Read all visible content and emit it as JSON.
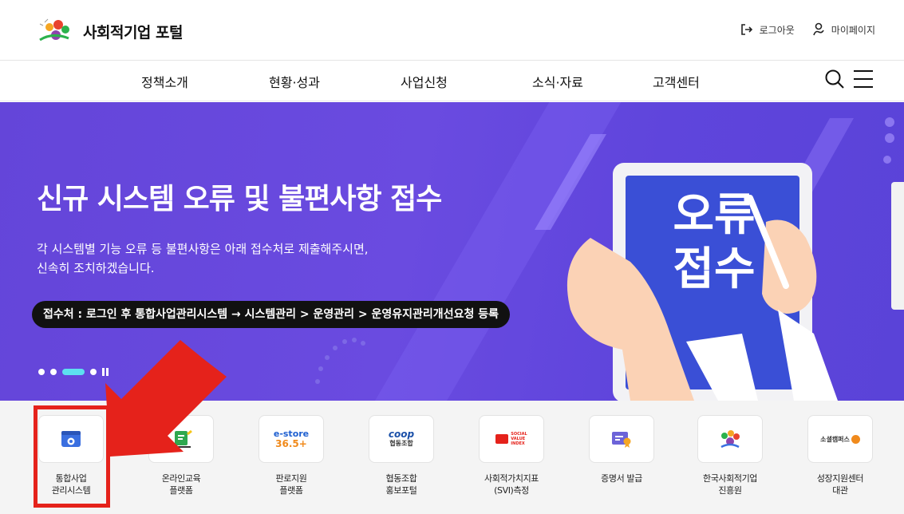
{
  "header": {
    "logo_text": "사회적기업 포털",
    "logout_label": "로그아웃",
    "mypage_label": "마이페이지"
  },
  "gnb": {
    "items": [
      {
        "label": "정책소개"
      },
      {
        "label": "현황·성과"
      },
      {
        "label": "사업신청"
      },
      {
        "label": "소식·자료"
      },
      {
        "label": "고객센터"
      }
    ]
  },
  "hero": {
    "title": "신규 시스템 오류 및 불편사항 접수",
    "desc_line1": "각 시스템별 기능 오류 등 불편사항은 아래 접수처로 제출해주시면,",
    "desc_line2": "신속히 조치하겠습니다.",
    "pill": "접수처 : 로그인 후 통합사업관리시스템 → 시스템관리 > 운영관리 > 운영유지관리개선요청 등록",
    "tablet_line1": "오류",
    "tablet_line2": "접수"
  },
  "quick_links": [
    {
      "line1": "통합사업",
      "line2": "관리시스템"
    },
    {
      "line1": "온라인교육",
      "line2": "플랫폼"
    },
    {
      "line1": "판로지원",
      "line2": "플랫폼",
      "logo_top": "e-store",
      "logo_bottom": "36.5+"
    },
    {
      "line1": "협동조합",
      "line2": "홍보포털",
      "logo_top": "coop",
      "logo_bottom": "협동조합"
    },
    {
      "line1": "사회적가치지표",
      "line2": "(SVI)측정",
      "logo_top": "SOCIAL",
      "logo_mid": "VALUE",
      "logo_bottom": "INDEX"
    },
    {
      "line1": "증명서 발급",
      "line2": ""
    },
    {
      "line1": "한국사회적기업",
      "line2": "진흥원"
    },
    {
      "line1": "성장지원센터",
      "line2": "대관",
      "logo_text": "소셜캠퍼스"
    }
  ],
  "colors": {
    "hero_bg": "#6445d9",
    "accent_cyan": "#5de0f0",
    "highlight_red": "#e5221b"
  }
}
